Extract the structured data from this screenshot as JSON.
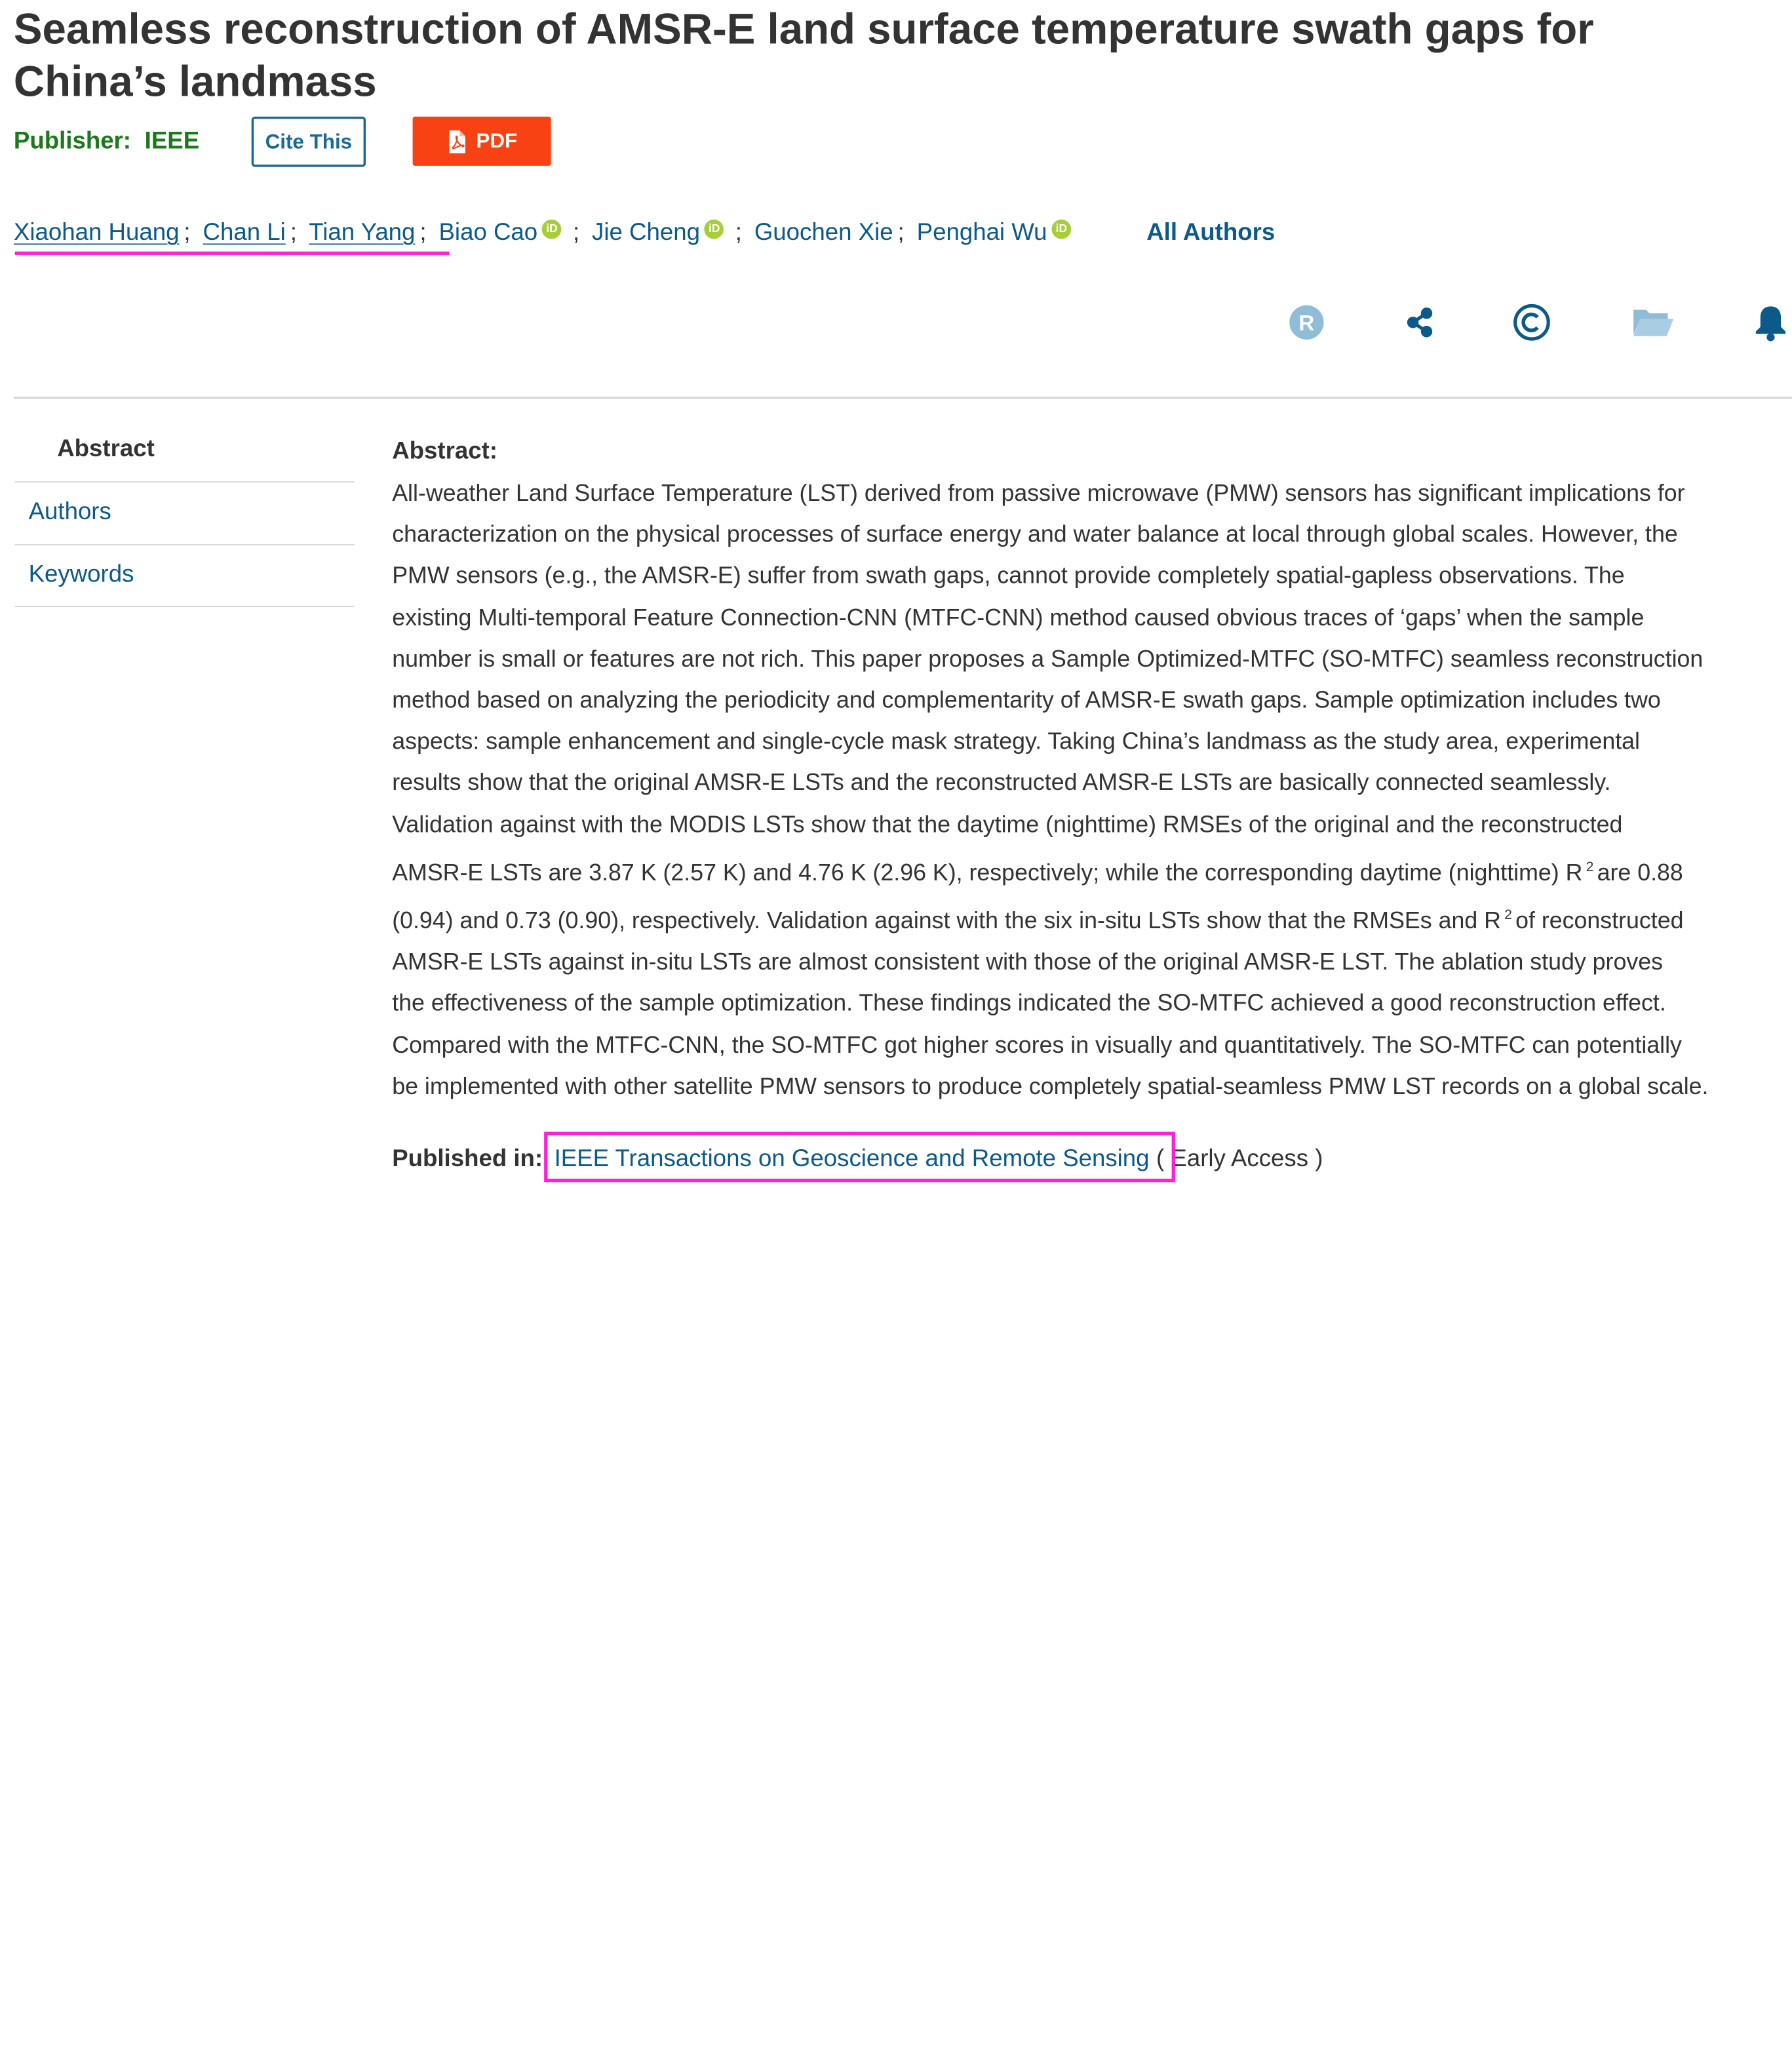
{
  "title": "Seamless reconstruction of AMSR-E land surface temperature swath gaps for China’s landmass",
  "publisher": {
    "label": "Publisher:",
    "value": "IEEE"
  },
  "buttons": {
    "cite": "Cite This",
    "pdf": "PDF"
  },
  "authors": [
    {
      "name": "Xiaohan Huang",
      "orcid": false
    },
    {
      "name": "Chan Li",
      "orcid": false
    },
    {
      "name": "Tian Yang",
      "orcid": false
    },
    {
      "name": "Biao Cao",
      "orcid": true
    },
    {
      "name": "Jie Cheng",
      "orcid": true
    },
    {
      "name": "Guochen Xie",
      "orcid": false
    },
    {
      "name": "Penghai Wu",
      "orcid": true
    }
  ],
  "orcid_badge": "iD",
  "all_authors": "All Authors",
  "toolbar_icons": [
    "rights-icon",
    "share-icon",
    "copyright-icon",
    "folder-icon",
    "bell-icon"
  ],
  "toolbar_glyphs": {
    "rights": "R",
    "copyright": "©"
  },
  "sidebar": {
    "heading": "Abstract",
    "links": [
      "Authors",
      "Keywords"
    ]
  },
  "abstract": {
    "label": "Abstract:",
    "lines": [
      "All-weather Land Surface Temperature (LST) derived from passive microwave (PMW) sensors has significant implications for",
      "characterization on the physical processes of surface energy and water balance at local through global scales. However, the",
      "PMW sensors (e.g., the AMSR-E) suffer from swath gaps, cannot provide completely spatial-gapless observations. The",
      "existing Multi-temporal Feature Connection-CNN (MTFC-CNN) method caused obvious traces of ‘gaps’ when the sample",
      "number is small or features are not rich. This paper proposes a Sample Optimized-MTFC (SO-MTFC) seamless reconstruction",
      "method based on analyzing the periodicity and complementarity of AMSR-E swath gaps. Sample optimization includes two",
      "aspects: sample enhancement and single-cycle mask strategy. Taking China’s landmass as the study area, experimental",
      "results show that the original AMSR-E LSTs and the reconstructed AMSR-E LSTs are basically connected seamlessly.",
      "Validation against with the MODIS LSTs show that the daytime (nighttime) RMSEs of the original and the reconstructed",
      "AMSR-E LSTs are 3.87 K (2.57 K) and 4.76 K (2.96 K), respectively; while the corresponding daytime (nighttime) R",
      "(0.94) and 0.73 (0.90), respectively. Validation against with the six in-situ LSTs show that the RMSEs and R",
      "AMSR-E LSTs against in-situ LSTs are almost consistent with those of the original AMSR-E LST. The ablation study proves",
      "the effectiveness of the sample optimization. These findings indicated the SO-MTFC achieved a good reconstruction effect.",
      "Compared with the MTFC-CNN, the SO-MTFC got higher scores in visually and quantitatively. The SO-MTFC can potentially",
      "be implemented with other satellite PMW sensors to produce completely spatial-seamless PMW LST records on a global scale."
    ],
    "line10_tail": "are 0.88",
    "line11_tail": "of reconstructed",
    "superscript": "2"
  },
  "published_in": {
    "label": "Published in:",
    "journal": "IEEE Transactions on Geoscience and Remote Sensing",
    "extra": "( Early Access )"
  },
  "colors": {
    "link": "#0b5a8a",
    "publisher": "#1a7a1a",
    "pdf": "#f84214",
    "highlight": "#ff1fd6",
    "orcid": "#a6ce39",
    "toolbar_light": "#8fbcd6",
    "toolbar_dark": "#0b5a8a"
  }
}
